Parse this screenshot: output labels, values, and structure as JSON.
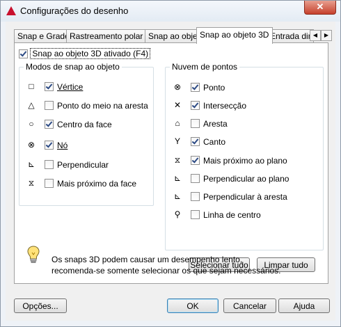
{
  "window": {
    "title": "Configurações do desenho",
    "close_glyph": "✕"
  },
  "tabs": [
    {
      "label": "Snap e Grade",
      "active": false
    },
    {
      "label": "Rastreamento polar",
      "active": false
    },
    {
      "label": "Snap ao objeto",
      "active": false
    },
    {
      "label": "Snap ao objeto 3D",
      "active": true
    },
    {
      "label": "Entrada dinâmica",
      "active": false
    }
  ],
  "tab_scroll": {
    "left": "◀",
    "right": "▶"
  },
  "master_toggle": {
    "label": "Snap ao objeto 3D ativado (F4)",
    "checked": true
  },
  "snap_modes": {
    "title": "Modos de snap ao objeto",
    "items": [
      {
        "symbol": "□",
        "label": "Vértice",
        "checked": true
      },
      {
        "symbol": "△",
        "label": "Ponto do meio na aresta",
        "checked": false
      },
      {
        "symbol": "○",
        "label": "Centro da face",
        "checked": true
      },
      {
        "symbol": "⊗",
        "label": "Nó",
        "checked": true
      },
      {
        "symbol": "⊾",
        "label": "Perpendicular",
        "checked": false
      },
      {
        "symbol": "⧖",
        "label": "Mais próximo da face",
        "checked": false
      }
    ]
  },
  "point_cloud": {
    "title": "Nuvem de pontos",
    "items": [
      {
        "symbol": "⊗",
        "label": "Ponto",
        "checked": true
      },
      {
        "symbol": "✕",
        "label": "Intersecção",
        "checked": true
      },
      {
        "symbol": "⌂",
        "label": "Aresta",
        "checked": false
      },
      {
        "symbol": "Y",
        "label": "Canto",
        "checked": true
      },
      {
        "symbol": "⧖",
        "label": "Mais próximo ao plano",
        "checked": true
      },
      {
        "symbol": "⊾",
        "label": "Perpendicular ao plano",
        "checked": false
      },
      {
        "symbol": "⊾",
        "label": "Perpendicular à aresta",
        "checked": false
      },
      {
        "symbol": "⚲",
        "label": "Linha de centro",
        "checked": false
      }
    ]
  },
  "actions": {
    "select_all": "Selecionar tudo",
    "clear_all": "Limpar tudo"
  },
  "note": {
    "icon": "lightbulb-icon",
    "line1": "Os snaps 3D podem causar um desempenho lento,",
    "line2": "recomenda-se somente selecionar os que sejam necessários."
  },
  "footer": {
    "options": "Opções...",
    "ok": "OK",
    "cancel": "Cancelar",
    "help": "Ajuda"
  }
}
